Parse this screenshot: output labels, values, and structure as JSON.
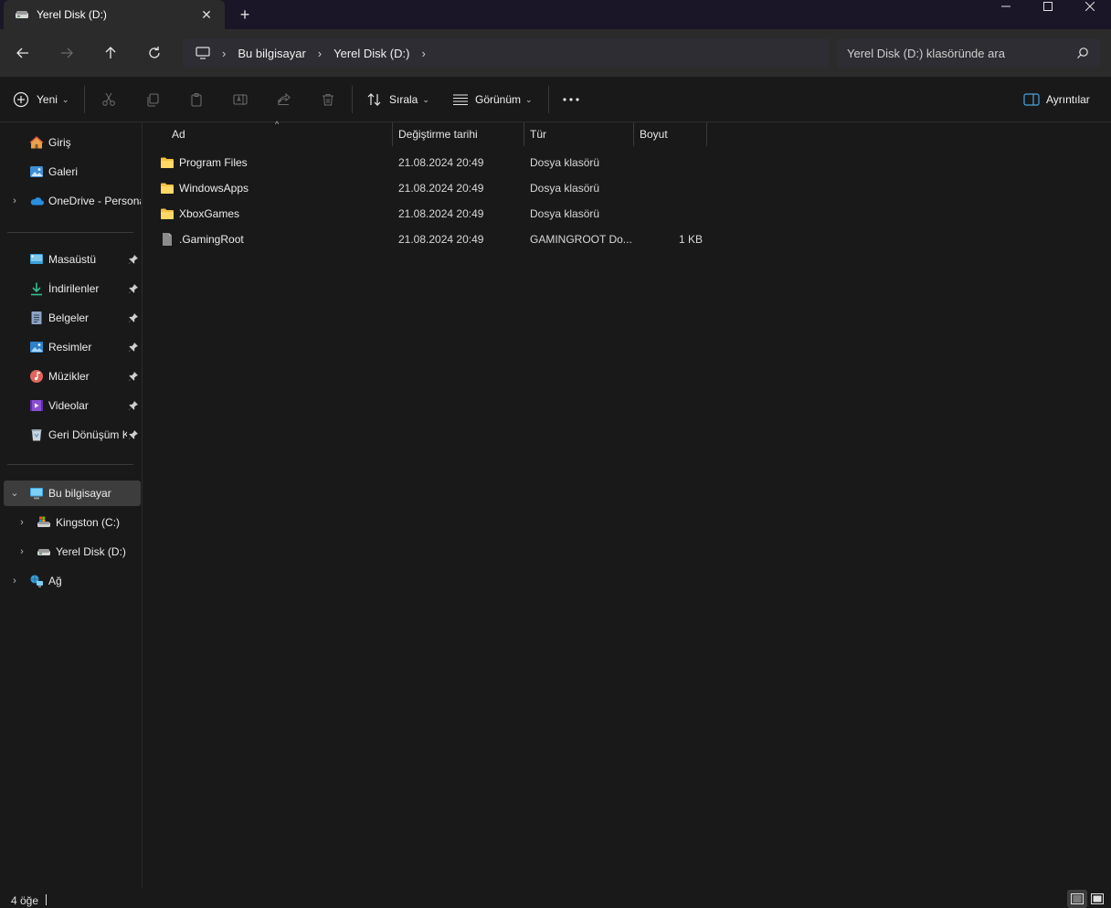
{
  "window": {
    "tab_title": "Yerel Disk (D:)",
    "tab_close": "✕",
    "new_tab": "+"
  },
  "nav": {
    "breadcrumb": [
      "Bu bilgisayar",
      "Yerel Disk (D:)"
    ],
    "search_placeholder": "Yerel Disk (D:) klasöründe ara"
  },
  "toolbar": {
    "new_label": "Yeni",
    "sort_label": "Sırala",
    "view_label": "Görünüm",
    "details_label": "Ayrıntılar"
  },
  "sidebar": {
    "quick": [
      {
        "label": "Giriş",
        "icon": "home-icon"
      },
      {
        "label": "Galeri",
        "icon": "gallery-icon"
      },
      {
        "label": "OneDrive - Personal",
        "icon": "onedrive-icon"
      }
    ],
    "pinned": [
      {
        "label": "Masaüstü",
        "icon": "desktop-icon"
      },
      {
        "label": "İndirilenler",
        "icon": "download-icon"
      },
      {
        "label": "Belgeler",
        "icon": "documents-icon"
      },
      {
        "label": "Resimler",
        "icon": "pictures-icon"
      },
      {
        "label": "Müzikler",
        "icon": "music-icon"
      },
      {
        "label": "Videolar",
        "icon": "videos-icon"
      },
      {
        "label": "Geri Dönüşüm Kutusu",
        "icon": "recycle-bin-icon"
      }
    ],
    "this_pc": {
      "label": "Bu bilgisayar",
      "icon": "this-pc-icon"
    },
    "drives": [
      {
        "label": "Kingston (C:)",
        "icon": "system-drive-icon"
      },
      {
        "label": "Yerel Disk (D:)",
        "icon": "local-disk-icon"
      }
    ],
    "network": {
      "label": "Ağ",
      "icon": "network-icon"
    }
  },
  "columns": {
    "name": "Ad",
    "date": "Değiştirme tarihi",
    "type": "Tür",
    "size": "Boyut"
  },
  "files": [
    {
      "name": "Program Files",
      "date": "21.08.2024 20:49",
      "type": "Dosya klasörü",
      "size": "",
      "icon": "folder-icon"
    },
    {
      "name": "WindowsApps",
      "date": "21.08.2024 20:49",
      "type": "Dosya klasörü",
      "size": "",
      "icon": "folder-icon"
    },
    {
      "name": "XboxGames",
      "date": "21.08.2024 20:49",
      "type": "Dosya klasörü",
      "size": "",
      "icon": "folder-icon"
    },
    {
      "name": ".GamingRoot",
      "date": "21.08.2024 20:49",
      "type": "GAMINGROOT Do...",
      "size": "1 KB",
      "icon": "file-icon"
    }
  ],
  "status": {
    "item_count": "4 öğe"
  },
  "colors": {
    "titlebar": "#1b1528",
    "navbar": "#2b2b2b",
    "background": "#191919",
    "folder": "#f5c342",
    "accent": "#4aa3df"
  }
}
